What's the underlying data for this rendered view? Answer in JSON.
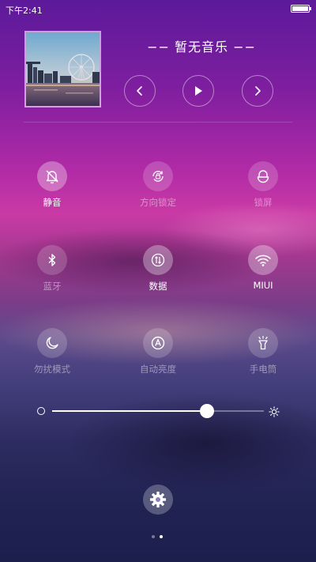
{
  "status_bar": {
    "time": "下午2:41",
    "battery_level": 1.0
  },
  "music": {
    "title": "−− 暂无音乐 −−",
    "album_art_icon": "city-skyline-ferris-wheel-image"
  },
  "media_controls": [
    {
      "name": "previous-button",
      "icon": "chevron-left-icon"
    },
    {
      "name": "play-button",
      "icon": "play-icon"
    },
    {
      "name": "next-button",
      "icon": "chevron-right-icon"
    }
  ],
  "toggles": [
    {
      "label": "静音",
      "icon": "bell-off-icon",
      "on": true
    },
    {
      "label": "方向锁定",
      "icon": "rotation-lock-icon",
      "on": false
    },
    {
      "label": "锁屏",
      "icon": "lock-icon",
      "on": false
    },
    {
      "label": "蓝牙",
      "icon": "bluetooth-icon",
      "on": false
    },
    {
      "label": "数据",
      "icon": "mobile-data-icon",
      "on": true
    },
    {
      "label": "MIUI",
      "icon": "wifi-icon",
      "on": true
    },
    {
      "label": "勿扰模式",
      "icon": "moon-icon",
      "on": false
    },
    {
      "label": "自动亮度",
      "icon": "auto-brightness-icon",
      "on": false
    },
    {
      "label": "手电筒",
      "icon": "flashlight-icon",
      "on": false
    }
  ],
  "brightness": {
    "level": 0.73
  },
  "pager": {
    "pages": 2,
    "current": 2
  },
  "colors": {
    "accent_white": "#ffffff",
    "background_top": "#5c1a9a",
    "background_bottom": "#1c1e4c"
  }
}
